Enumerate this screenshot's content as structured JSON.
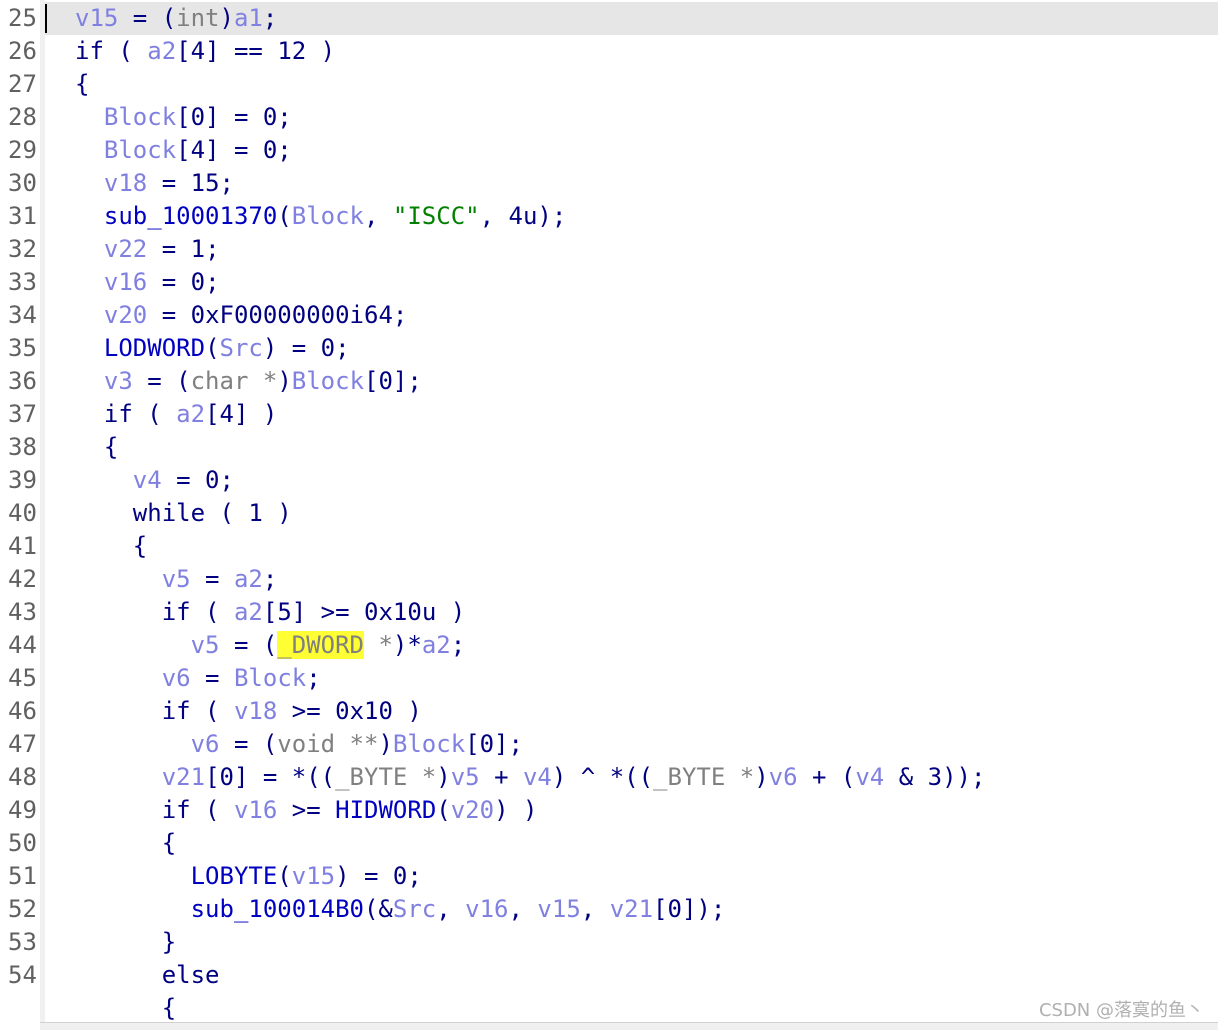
{
  "editor": {
    "current_line": 25,
    "highlight_word": "_DWORD",
    "lines": [
      {
        "n": "25",
        "tokens": [
          [
            "var",
            "v15"
          ],
          [
            "punc",
            " = ("
          ],
          [
            "type",
            "int"
          ],
          [
            "punc",
            ")"
          ],
          [
            "var",
            "a1"
          ],
          [
            "punc",
            ";"
          ]
        ]
      },
      {
        "n": "26",
        "tokens": [
          [
            "kw",
            "if"
          ],
          [
            "punc",
            " ( "
          ],
          [
            "var",
            "a2"
          ],
          [
            "punc",
            "[4] == 12 )"
          ]
        ]
      },
      {
        "n": "27",
        "tokens": [
          [
            "punc",
            "{"
          ]
        ]
      },
      {
        "n": "28",
        "tokens": [
          [
            "punc",
            "  "
          ],
          [
            "var",
            "Block"
          ],
          [
            "punc",
            "[0] = 0;"
          ]
        ]
      },
      {
        "n": "29",
        "tokens": [
          [
            "punc",
            "  "
          ],
          [
            "var",
            "Block"
          ],
          [
            "punc",
            "[4] = 0;"
          ]
        ]
      },
      {
        "n": "30",
        "tokens": [
          [
            "punc",
            "  "
          ],
          [
            "var",
            "v18"
          ],
          [
            "punc",
            " = 15;"
          ]
        ]
      },
      {
        "n": "31",
        "tokens": [
          [
            "punc",
            "  "
          ],
          [
            "fn",
            "sub_10001370"
          ],
          [
            "punc",
            "("
          ],
          [
            "var",
            "Block"
          ],
          [
            "punc",
            ", "
          ],
          [
            "str",
            "\"ISCC\""
          ],
          [
            "punc",
            ", 4u);"
          ]
        ]
      },
      {
        "n": "32",
        "tokens": [
          [
            "punc",
            "  "
          ],
          [
            "var",
            "v22"
          ],
          [
            "punc",
            " = 1;"
          ]
        ]
      },
      {
        "n": "33",
        "tokens": [
          [
            "punc",
            "  "
          ],
          [
            "var",
            "v16"
          ],
          [
            "punc",
            " = 0;"
          ]
        ]
      },
      {
        "n": "34",
        "tokens": [
          [
            "punc",
            "  "
          ],
          [
            "var",
            "v20"
          ],
          [
            "punc",
            " = 0xF00000000i64;"
          ]
        ]
      },
      {
        "n": "35",
        "tokens": [
          [
            "punc",
            "  "
          ],
          [
            "fn",
            "LODWORD"
          ],
          [
            "punc",
            "("
          ],
          [
            "var",
            "Src"
          ],
          [
            "punc",
            ") = 0;"
          ]
        ]
      },
      {
        "n": "36",
        "tokens": [
          [
            "punc",
            "  "
          ],
          [
            "var",
            "v3"
          ],
          [
            "punc",
            " = ("
          ],
          [
            "type",
            "char *"
          ],
          [
            "punc",
            ")"
          ],
          [
            "var",
            "Block"
          ],
          [
            "punc",
            "[0];"
          ]
        ]
      },
      {
        "n": "37",
        "tokens": [
          [
            "punc",
            "  "
          ],
          [
            "kw",
            "if"
          ],
          [
            "punc",
            " ( "
          ],
          [
            "var",
            "a2"
          ],
          [
            "punc",
            "[4] )"
          ]
        ]
      },
      {
        "n": "38",
        "tokens": [
          [
            "punc",
            "  {"
          ]
        ]
      },
      {
        "n": "39",
        "tokens": [
          [
            "punc",
            "    "
          ],
          [
            "var",
            "v4"
          ],
          [
            "punc",
            " = 0;"
          ]
        ]
      },
      {
        "n": "40",
        "tokens": [
          [
            "punc",
            "    "
          ],
          [
            "kw",
            "while"
          ],
          [
            "punc",
            " ( 1 )"
          ]
        ]
      },
      {
        "n": "41",
        "tokens": [
          [
            "punc",
            "    {"
          ]
        ]
      },
      {
        "n": "42",
        "tokens": [
          [
            "punc",
            "      "
          ],
          [
            "var",
            "v5"
          ],
          [
            "punc",
            " = "
          ],
          [
            "var",
            "a2"
          ],
          [
            "punc",
            ";"
          ]
        ]
      },
      {
        "n": "43",
        "tokens": [
          [
            "punc",
            "      "
          ],
          [
            "kw",
            "if"
          ],
          [
            "punc",
            " ( "
          ],
          [
            "var",
            "a2"
          ],
          [
            "punc",
            "[5] >= 0x10u )"
          ]
        ]
      },
      {
        "n": "44",
        "tokens": [
          [
            "punc",
            "        "
          ],
          [
            "var",
            "v5"
          ],
          [
            "punc",
            " = ("
          ],
          [
            "hl",
            "_DWORD"
          ],
          [
            "type",
            " *"
          ],
          [
            "punc",
            ")*"
          ],
          [
            "var",
            "a2"
          ],
          [
            "punc",
            ";"
          ]
        ]
      },
      {
        "n": "45",
        "tokens": [
          [
            "punc",
            "      "
          ],
          [
            "var",
            "v6"
          ],
          [
            "punc",
            " = "
          ],
          [
            "var",
            "Block"
          ],
          [
            "punc",
            ";"
          ]
        ]
      },
      {
        "n": "46",
        "tokens": [
          [
            "punc",
            "      "
          ],
          [
            "kw",
            "if"
          ],
          [
            "punc",
            " ( "
          ],
          [
            "var",
            "v18"
          ],
          [
            "punc",
            " >= 0x10 )"
          ]
        ]
      },
      {
        "n": "47",
        "tokens": [
          [
            "punc",
            "        "
          ],
          [
            "var",
            "v6"
          ],
          [
            "punc",
            " = ("
          ],
          [
            "type",
            "void **"
          ],
          [
            "punc",
            ")"
          ],
          [
            "var",
            "Block"
          ],
          [
            "punc",
            "[0];"
          ]
        ]
      },
      {
        "n": "48",
        "tokens": [
          [
            "punc",
            "      "
          ],
          [
            "var",
            "v21"
          ],
          [
            "punc",
            "[0] = *(("
          ],
          [
            "type",
            "_BYTE *"
          ],
          [
            "punc",
            ")"
          ],
          [
            "var",
            "v5"
          ],
          [
            "punc",
            " + "
          ],
          [
            "var",
            "v4"
          ],
          [
            "punc",
            ") ^ *(("
          ],
          [
            "type",
            "_BYTE *"
          ],
          [
            "punc",
            ")"
          ],
          [
            "var",
            "v6"
          ],
          [
            "punc",
            " + ("
          ],
          [
            "var",
            "v4"
          ],
          [
            "punc",
            " & 3));"
          ]
        ]
      },
      {
        "n": "49",
        "tokens": [
          [
            "punc",
            "      "
          ],
          [
            "kw",
            "if"
          ],
          [
            "punc",
            " ( "
          ],
          [
            "var",
            "v16"
          ],
          [
            "punc",
            " >= "
          ],
          [
            "fn",
            "HIDWORD"
          ],
          [
            "punc",
            "("
          ],
          [
            "var",
            "v20"
          ],
          [
            "punc",
            ") )"
          ]
        ]
      },
      {
        "n": "50",
        "tokens": [
          [
            "punc",
            "      {"
          ]
        ]
      },
      {
        "n": "51",
        "tokens": [
          [
            "punc",
            "        "
          ],
          [
            "fn",
            "LOBYTE"
          ],
          [
            "punc",
            "("
          ],
          [
            "var",
            "v15"
          ],
          [
            "punc",
            ") = 0;"
          ]
        ]
      },
      {
        "n": "52",
        "tokens": [
          [
            "punc",
            "        "
          ],
          [
            "fn",
            "sub_100014B0"
          ],
          [
            "punc",
            "(&"
          ],
          [
            "var",
            "Src"
          ],
          [
            "punc",
            ", "
          ],
          [
            "var",
            "v16"
          ],
          [
            "punc",
            ", "
          ],
          [
            "var",
            "v15"
          ],
          [
            "punc",
            ", "
          ],
          [
            "var",
            "v21"
          ],
          [
            "punc",
            "[0]);"
          ]
        ]
      },
      {
        "n": "53",
        "tokens": [
          [
            "punc",
            "      }"
          ]
        ]
      },
      {
        "n": "54",
        "tokens": [
          [
            "punc",
            "      "
          ],
          [
            "kw",
            "else"
          ]
        ]
      },
      {
        "n": "",
        "tokens": [
          [
            "punc",
            "      {"
          ]
        ]
      }
    ]
  },
  "watermark": "CSDN @落寞的鱼丶"
}
